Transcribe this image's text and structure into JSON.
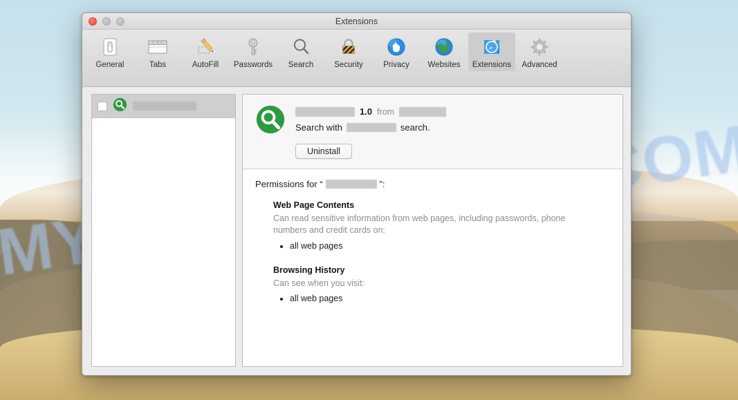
{
  "desktop": {
    "watermark": "MYANTISPYWARE.COM"
  },
  "window": {
    "title": "Extensions",
    "traffic_lights": [
      {
        "name": "close",
        "color": "#f5564b"
      },
      {
        "name": "minimize",
        "color": "#bcbcbc"
      },
      {
        "name": "zoom",
        "color": "#bcbcbc"
      }
    ]
  },
  "toolbar": {
    "items": [
      {
        "label": "General",
        "icon": "general-icon",
        "selected": false
      },
      {
        "label": "Tabs",
        "icon": "tabs-icon",
        "selected": false
      },
      {
        "label": "AutoFill",
        "icon": "autofill-icon",
        "selected": false
      },
      {
        "label": "Passwords",
        "icon": "passwords-icon",
        "selected": false
      },
      {
        "label": "Search",
        "icon": "search-icon",
        "selected": false
      },
      {
        "label": "Security",
        "icon": "security-icon",
        "selected": false
      },
      {
        "label": "Privacy",
        "icon": "privacy-icon",
        "selected": false
      },
      {
        "label": "Websites",
        "icon": "websites-icon",
        "selected": false
      },
      {
        "label": "Extensions",
        "icon": "extensions-icon",
        "selected": true
      },
      {
        "label": "Advanced",
        "icon": "advanced-icon",
        "selected": false
      }
    ]
  },
  "sidebar": {
    "rows": [
      {
        "checked": false,
        "icon": "green-magnifier-icon",
        "name_redacted": true,
        "name": "",
        "selected": true
      }
    ]
  },
  "detail": {
    "icon": "green-magnifier-icon",
    "name_redacted": true,
    "name": "",
    "version": "1.0",
    "from_label": "from",
    "developer_redacted": true,
    "developer": "",
    "description_prefix": "Search with",
    "description_redacted": true,
    "description_name": "",
    "description_suffix": "search.",
    "uninstall_label": "Uninstall",
    "permissions_prefix": "Permissions for “",
    "permissions_subject_redacted": true,
    "permissions_subject": "",
    "permissions_suffix": "”:",
    "permission_groups": [
      {
        "title": "Web Page Contents",
        "description": "Can read sensitive information from web pages, including passwords, phone numbers and credit cards on:",
        "items": [
          "all web pages"
        ]
      },
      {
        "title": "Browsing History",
        "description": "Can see when you visit:",
        "items": [
          "all web pages"
        ]
      }
    ]
  },
  "colors": {
    "extension_icon_green": "#2e9a40",
    "selected_tab_bg": "#cdcdcd",
    "window_chrome": "#ececec",
    "watermark_blue": "#a8c4ec"
  }
}
